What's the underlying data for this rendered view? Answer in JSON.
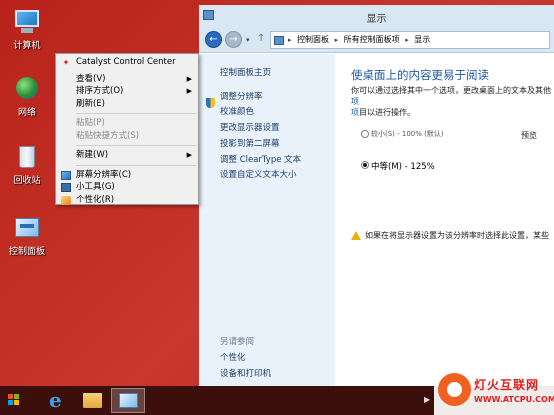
{
  "desktop": {
    "icons": [
      {
        "label": "计算机"
      },
      {
        "label": "网络"
      },
      {
        "label": "回收站"
      },
      {
        "label": "控制面板"
      }
    ]
  },
  "context_menu": {
    "items": [
      {
        "label": "Catalyst Control Center",
        "icon": "amd-icon"
      },
      {
        "label": "查看(V)",
        "submenu": true
      },
      {
        "label": "排序方式(O)",
        "submenu": true
      },
      {
        "label": "刷新(E)"
      },
      {
        "label": "粘贴(P)",
        "disabled": true
      },
      {
        "label": "粘贴快捷方式(S)",
        "disabled": true
      },
      {
        "label": "新建(W)",
        "submenu": true
      },
      {
        "label": "屏幕分辨率(C)",
        "icon": "screen-resolution-icon"
      },
      {
        "label": "小工具(G)",
        "icon": "gadgets-icon"
      },
      {
        "label": "个性化(R)",
        "icon": "personalize-icon"
      }
    ]
  },
  "window": {
    "title": "显示",
    "breadcrumbs": [
      "控制面板",
      "所有控制面板项",
      "显示"
    ],
    "left_pane": {
      "home": "控制面板主页",
      "links": [
        "调整分辨率",
        "校准颜色",
        "更改显示器设置",
        "投影到第二屏幕",
        "调整 ClearType 文本",
        "设置自定义文本大小"
      ],
      "see_also_heading": "另请参阅",
      "see_also": [
        "个性化",
        "设备和打印机"
      ]
    },
    "content": {
      "title": "使桌面上的内容更易于阅读",
      "description_line1": "你可以通过选择其中一个选项，更改桌面上的文本及其他",
      "description_link": "项",
      "description_line2": "目以进行操作。",
      "option_small": "较小(S) - 100% (默认)",
      "option_medium": "中等(M) - 125%",
      "selected_option": "medium",
      "preview_label": "预览",
      "warning": "如果在将显示器设置为该分辨率时选择此设置，某些"
    }
  },
  "taskbar": {
    "apps": [
      "internet-explorer-icon",
      "file-explorer-icon",
      "control-panel-icon"
    ]
  },
  "watermark": {
    "name": "灯火互联网",
    "url": "WWW.ATCPU.COM"
  }
}
